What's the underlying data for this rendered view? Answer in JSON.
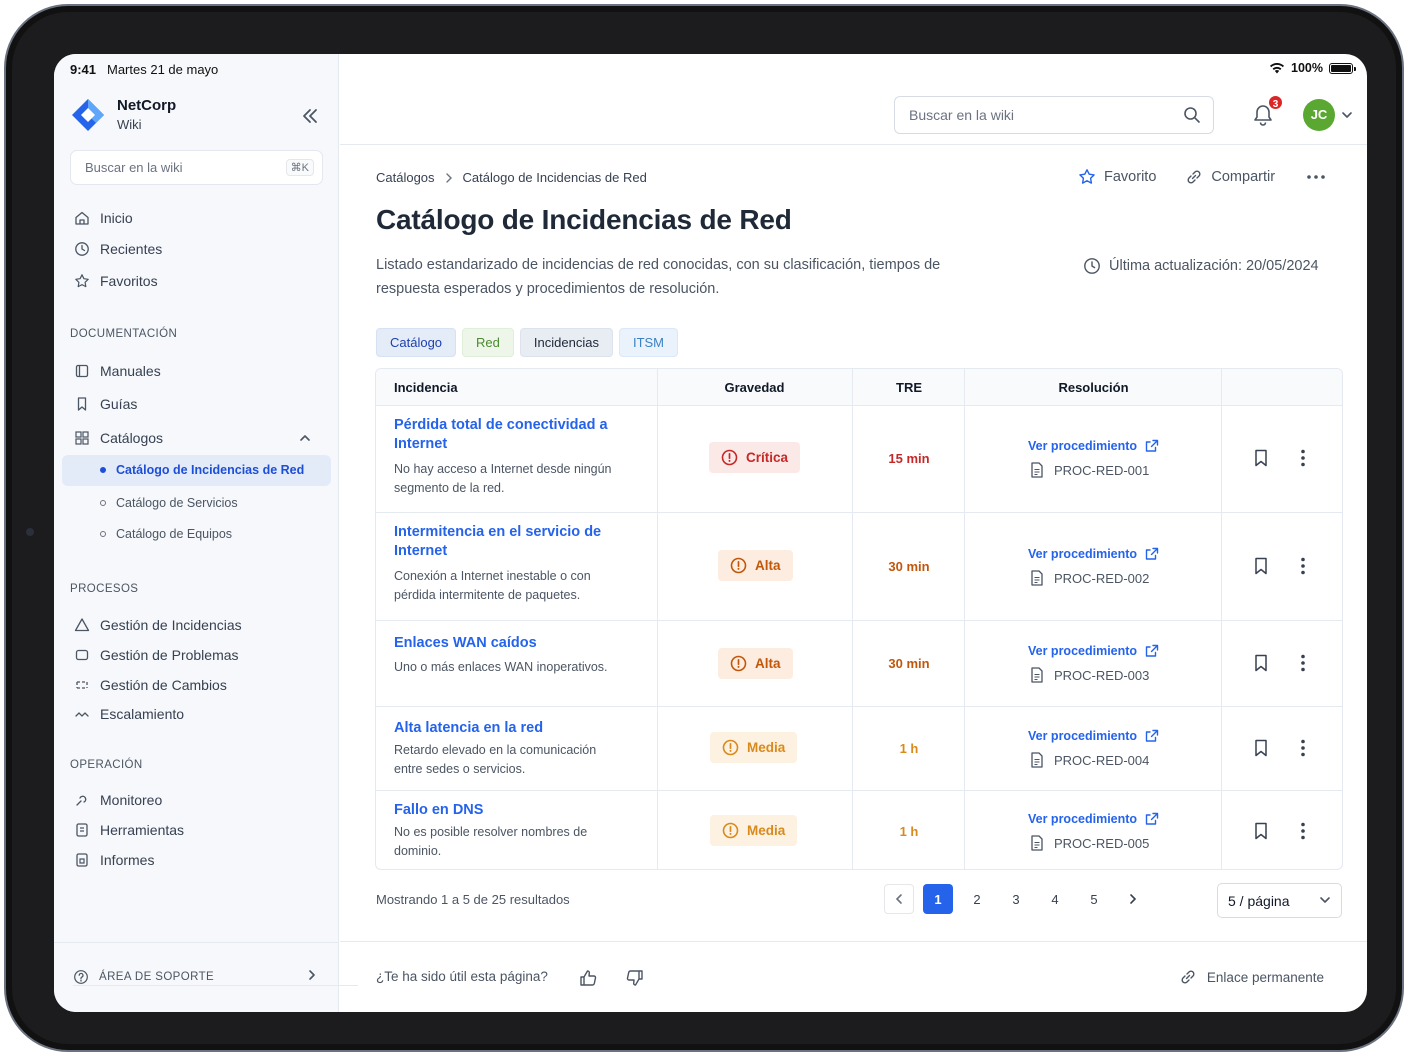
{
  "status_bar": {
    "time": "9:41",
    "date": "Martes 21 de mayo",
    "battery": "100%"
  },
  "brand": {
    "name": "NetCorp",
    "sub": "Wiki"
  },
  "sidebar": {
    "search_placeholder": "Buscar en la wiki",
    "shortcut": "⌘K",
    "top_items": [
      {
        "label": "Inicio",
        "icon": "home-icon"
      },
      {
        "label": "Recientes",
        "icon": "clock-icon"
      },
      {
        "label": "Favoritos",
        "icon": "star-icon"
      }
    ],
    "sections": {
      "documentacion": {
        "label": "DOCUMENTACIÓN",
        "items": [
          {
            "label": "Manuales",
            "icon": "book-icon"
          },
          {
            "label": "Guías",
            "icon": "bookmark-icon"
          },
          {
            "label": "Catálogos",
            "icon": "grid-icon",
            "expanded": true
          }
        ],
        "subitems": [
          {
            "label": "Catálogo de Incidencias de Red",
            "active": true
          },
          {
            "label": "Catálogo de Servicios",
            "active": false
          },
          {
            "label": "Catálogo de Equipos",
            "active": false
          }
        ]
      },
      "procesos": {
        "label": "PROCESOS",
        "items": [
          {
            "label": "Gestión de Incidencias",
            "icon": "warning-icon"
          },
          {
            "label": "Gestión de Problemas",
            "icon": "cycle-icon"
          },
          {
            "label": "Gestión de Cambios",
            "icon": "swap-icon"
          },
          {
            "label": "Escalamiento",
            "icon": "escalate-icon"
          }
        ]
      },
      "operacion": {
        "label": "OPERACIÓN",
        "items": [
          {
            "label": "Monitoreo",
            "icon": "monitor-icon"
          },
          {
            "label": "Herramientas",
            "icon": "tools-icon"
          },
          {
            "label": "Informes",
            "icon": "report-icon"
          }
        ]
      }
    },
    "support": "ÁREA DE SOPORTE"
  },
  "header": {
    "search_placeholder": "Buscar en la wiki",
    "notifications": "3",
    "avatar": "JC"
  },
  "breadcrumb": [
    "Catálogos",
    "Catálogo de Incidencias de Red"
  ],
  "actions": {
    "favorite": "Favorito",
    "share": "Compartir"
  },
  "page": {
    "title": "Catálogo de Incidencias de Red",
    "description": "Listado estandarizado de incidencias de red conocidas, con su clasificación, tiempos de respuesta esperados y procedimientos de resolución.",
    "updated": "Última actualización: 20/05/2024"
  },
  "tags": [
    {
      "label": "Catálogo",
      "bg": "#e4ecf8",
      "fg": "#1e40af",
      "border": "#d6e1f3"
    },
    {
      "label": "Red",
      "bg": "#eef6ea",
      "fg": "#4d8a33",
      "border": "#e0eeda"
    },
    {
      "label": "Incidencias",
      "bg": "#e8ecf3",
      "fg": "#1f2937",
      "border": "#dde3ec"
    },
    {
      "label": "ITSM",
      "bg": "#eaf2fb",
      "fg": "#3b82c4",
      "border": "#dbe8f7"
    }
  ],
  "table": {
    "headers": [
      "Incidencia",
      "Gravedad",
      "TRE",
      "Resolución"
    ],
    "link_label": "Ver procedimiento",
    "rows": [
      {
        "title": "Pérdida total de conectividad a Internet",
        "desc": "No hay acceso a Internet desde ningún segmento de la red.",
        "severity": "Crítica",
        "tre": "15 min",
        "code": "PROC-RED-001"
      },
      {
        "title": "Intermitencia en el servicio de Internet",
        "desc": "Conexión a Internet inestable o con pérdida intermitente de paquetes.",
        "severity": "Alta",
        "tre": "30 min",
        "code": "PROC-RED-002"
      },
      {
        "title": "Enlaces WAN caídos",
        "desc": "Uno o más enlaces WAN inoperativos.",
        "severity": "Alta",
        "tre": "30 min",
        "code": "PROC-RED-003"
      },
      {
        "title": "Alta latencia en la red",
        "desc": "Retardo elevado en la comunicación entre sedes o servicios.",
        "severity": "Media",
        "tre": "1 h",
        "code": "PROC-RED-004"
      },
      {
        "title": "Fallo en DNS",
        "desc": "No es posible resolver nombres de dominio.",
        "severity": "Media",
        "tre": "1 h",
        "code": "PROC-RED-005"
      }
    ],
    "severity_colors": {
      "Crítica": {
        "bg": "#fbe9e7",
        "fg": "#c62828",
        "tre": "#c62828"
      },
      "Alta": {
        "bg": "#fcede0",
        "fg": "#c2570c",
        "tre": "#c2570c"
      },
      "Media": {
        "bg": "#fdf1e2",
        "fg": "#d98a1c",
        "tre": "#d98a1c"
      }
    }
  },
  "pagination": {
    "summary": "Mostrando 1 a 5 de 25 resultados",
    "pages": [
      "1",
      "2",
      "3",
      "4",
      "5"
    ],
    "current": "1",
    "per_page": "5 / página"
  },
  "feedback": {
    "question": "¿Te ha sido útil esta página?",
    "permalink": "Enlace permanente"
  }
}
